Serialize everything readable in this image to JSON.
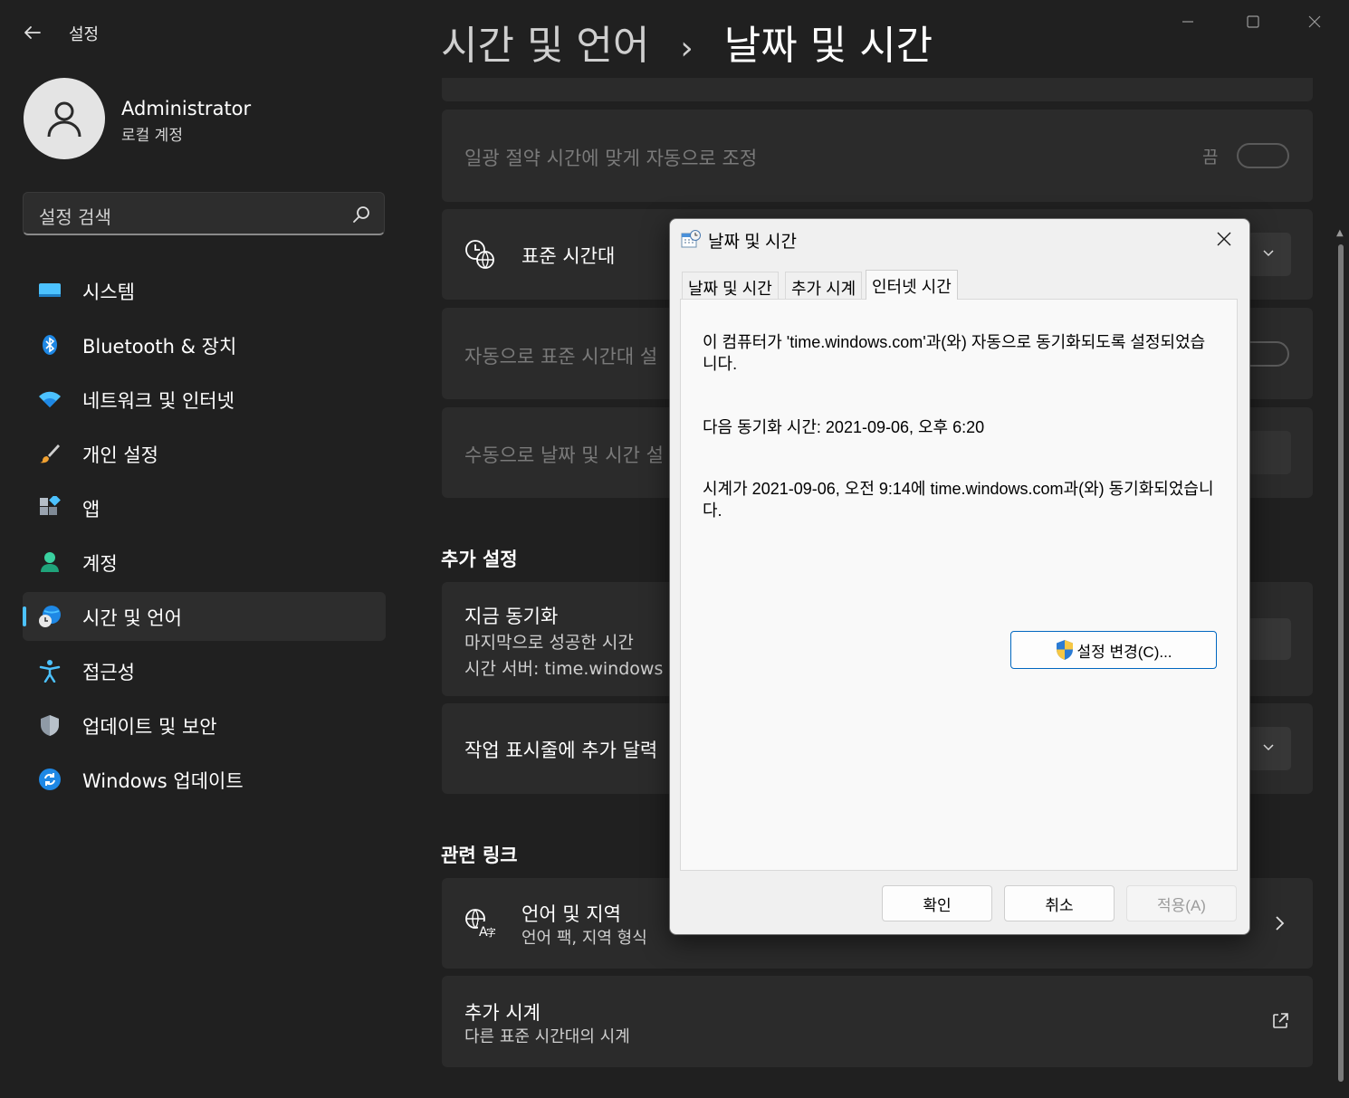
{
  "app": {
    "title": "설정",
    "window_controls": [
      "minimize",
      "maximize",
      "close"
    ]
  },
  "profile": {
    "name": "Administrator",
    "account_type": "로컬 계정"
  },
  "search": {
    "placeholder": "설정 검색"
  },
  "nav": {
    "selected": "시간 및 언어",
    "items": [
      {
        "label": "시스템",
        "icon": "monitor-icon"
      },
      {
        "label": "Bluetooth & 장치",
        "icon": "bluetooth-icon"
      },
      {
        "label": "네트워크 및 인터넷",
        "icon": "wifi-icon"
      },
      {
        "label": "개인 설정",
        "icon": "brush-icon"
      },
      {
        "label": "앱",
        "icon": "apps-icon"
      },
      {
        "label": "계정",
        "icon": "person-icon"
      },
      {
        "label": "시간 및 언어",
        "icon": "globe-clock-icon"
      },
      {
        "label": "접근성",
        "icon": "accessibility-icon"
      },
      {
        "label": "업데이트 및 보안",
        "icon": "shield-icon"
      },
      {
        "label": "Windows 업데이트",
        "icon": "sync-icon"
      }
    ]
  },
  "header": {
    "breadcrumb": [
      "시간 및 언어",
      "날짜 및 시간"
    ],
    "separator": "›"
  },
  "settings": {
    "dst_label": "일광 절약 시간에 맞게 자동으로 조정",
    "dst_state": "끔",
    "timezone_label": "표준 시간대",
    "auto_timezone_label": "자동으로 표준 시간대 설",
    "manual_label": "수동으로 날짜 및 시간 설",
    "additional_heading": "추가 설정",
    "sync_title": "지금 동기화",
    "sync_sub1": "마지막으로 성공한 시간",
    "sync_sub2": "시간 서버: time.windows",
    "taskbar_label": "작업 표시줄에 추가 달력",
    "related_heading": "관련 링크",
    "lang_title": "언어 및 지역",
    "lang_sub": "언어 팩, 지역 형식",
    "clocks_title": "추가 시계",
    "clocks_sub": "다른 표준 시간대의 시계"
  },
  "dialog": {
    "title": "날짜 및 시간",
    "tabs": [
      "날짜 및 시간",
      "추가 시계",
      "인터넷 시간"
    ],
    "active_tab": "인터넷 시간",
    "text1": "이 컴퓨터가 'time.windows.com'과(와) 자동으로 동기화되도록 설정되었습니다.",
    "text2": "다음 동기화 시간: 2021-09-06, 오후 6:20",
    "text3": "시계가 2021-09-06, 오전 9:14에 time.windows.com과(와) 동기화되었습니다.",
    "change_button": "설정 변경(C)...",
    "ok": "확인",
    "cancel": "취소",
    "apply": "적용(A)"
  },
  "colors": {
    "background": "#202020",
    "card": "#2b2b2b",
    "accent": "#4cc2ff",
    "dialog_bg": "#f0f0f0"
  }
}
